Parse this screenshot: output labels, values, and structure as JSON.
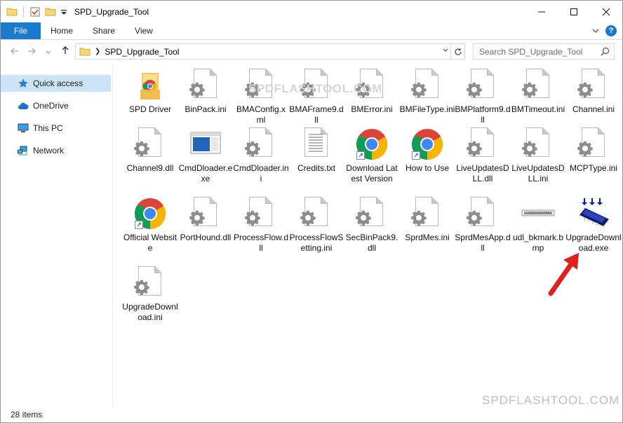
{
  "window": {
    "title": "SPD_Upgrade_Tool",
    "controls": [
      "minimize-icon",
      "maximize-icon",
      "close-icon"
    ]
  },
  "ribbon": {
    "tabs": [
      {
        "label": "File",
        "active": true
      },
      {
        "label": "Home"
      },
      {
        "label": "Share"
      },
      {
        "label": "View"
      }
    ]
  },
  "address": {
    "path": "SPD_Upgrade_Tool",
    "search_placeholder": "Search SPD_Upgrade_Tool"
  },
  "nav": {
    "items": [
      {
        "label": "Quick access",
        "icon": "star-icon",
        "selected": true
      },
      {
        "label": "OneDrive",
        "icon": "cloud-icon"
      },
      {
        "label": "This PC",
        "icon": "computer-icon"
      },
      {
        "label": "Network",
        "icon": "network-icon"
      }
    ]
  },
  "files": [
    {
      "label": "SPD Driver",
      "icon": "folder-icon"
    },
    {
      "label": "BinPack.ini",
      "icon": "settings-file-icon"
    },
    {
      "label": "BMAConfig.xml",
      "icon": "settings-file-icon"
    },
    {
      "label": "BMAFrame9.dll",
      "icon": "settings-file-icon"
    },
    {
      "label": "BMError.ini",
      "icon": "settings-file-icon"
    },
    {
      "label": "BMFileType.ini",
      "icon": "settings-file-icon"
    },
    {
      "label": "BMPlatform9.dll",
      "icon": "settings-file-icon"
    },
    {
      "label": "BMTimeout.ini",
      "icon": "settings-file-icon"
    },
    {
      "label": "Channel.ini",
      "icon": "settings-file-icon"
    },
    {
      "label": "Channel9.dll",
      "icon": "settings-file-icon"
    },
    {
      "label": "CmdDloader.exe",
      "icon": "app-window-icon"
    },
    {
      "label": "CmdDloader.ini",
      "icon": "settings-file-icon"
    },
    {
      "label": "Credits.txt",
      "icon": "text-file-icon"
    },
    {
      "label": "Download Latest Version",
      "icon": "chrome-shortcut-icon"
    },
    {
      "label": "How to Use",
      "icon": "chrome-shortcut-icon"
    },
    {
      "label": "LiveUpdatesDLL.dll",
      "icon": "settings-file-icon"
    },
    {
      "label": "LiveUpdatesDLL.ini",
      "icon": "settings-file-icon"
    },
    {
      "label": "MCPType.ini",
      "icon": "settings-file-icon"
    },
    {
      "label": "Official Website",
      "icon": "chrome-shortcut-icon"
    },
    {
      "label": "PortHound.dll",
      "icon": "settings-file-icon"
    },
    {
      "label": "ProcessFlow.dll",
      "icon": "settings-file-icon"
    },
    {
      "label": "ProcessFlowSetting.ini",
      "icon": "settings-file-icon"
    },
    {
      "label": "SecBinPack9.dll",
      "icon": "settings-file-icon"
    },
    {
      "label": "SprdMes.ini",
      "icon": "settings-file-icon"
    },
    {
      "label": "SprdMesApp.dll",
      "icon": "settings-file-icon"
    },
    {
      "label": "udl_bkmark.bmp",
      "icon": "bitmap-icon"
    },
    {
      "label": "UpgradeDownload.exe",
      "icon": "upgrade-chip-icon"
    },
    {
      "label": "UpgradeDownload.ini",
      "icon": "settings-file-icon"
    }
  ],
  "watermarks": {
    "center": "SPDFLASHTOOL.COM",
    "corner": "SPDFLASHTOOL.COM",
    "bitmap_text": "SPDFLASHTOOL.COM"
  },
  "status": {
    "count": "28 items"
  },
  "colors": {
    "accent": "#1979ca",
    "selection": "#cce4f7",
    "arrow": "#e0201b"
  }
}
